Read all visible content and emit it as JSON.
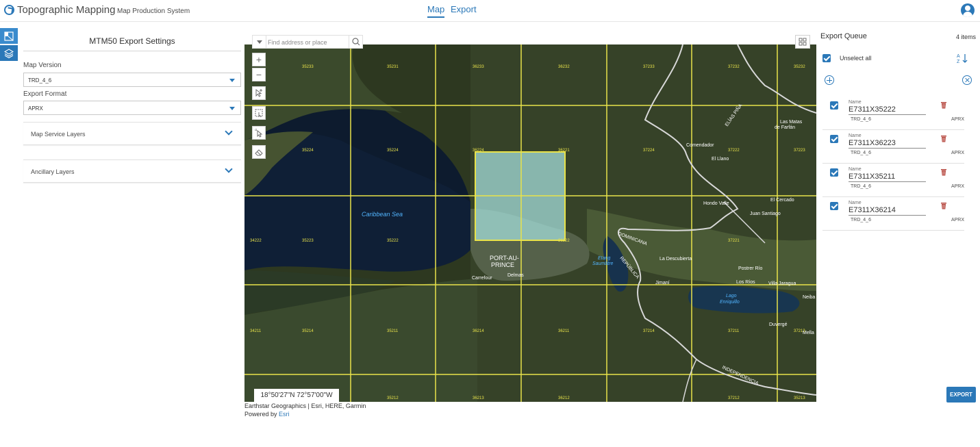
{
  "header": {
    "app_title": "Topographic Mapping",
    "app_subtitle": "Map Production System",
    "tabs": [
      {
        "label": "Map",
        "active": true
      },
      {
        "label": "Export",
        "active": false
      }
    ],
    "user_icon": "user-circle-icon"
  },
  "rail": {
    "items": [
      {
        "icon": "export-panel-icon",
        "active": true
      },
      {
        "icon": "layers-icon",
        "active": false
      }
    ]
  },
  "settings": {
    "title": "MTM50 Export Settings",
    "map_version_label": "Map Version",
    "map_version_value": "TRD_4_6",
    "export_format_label": "Export Format",
    "export_format_value": "APRX",
    "sections": [
      {
        "label": "Map Service Layers"
      },
      {
        "label": "Ancillary Layers"
      }
    ]
  },
  "map": {
    "search_placeholder": "Find address or place",
    "grid_labels": [
      "35233",
      "35231",
      "36233",
      "36232",
      "37233",
      "37232",
      "35232",
      "35224",
      "35224",
      "36224",
      "36221",
      "37224",
      "37222",
      "37223",
      "34222",
      "35223",
      "35222",
      "36222",
      "37221",
      "34211",
      "35214",
      "35211",
      "36214",
      "36211",
      "37214",
      "37211",
      "37213",
      "35212",
      "36213",
      "36212",
      "37212",
      "35213"
    ],
    "places": [
      "Comendador",
      "El Llano",
      "Hondo Valle",
      "El Cercado",
      "Juan Santiago",
      "PORT-AU-",
      "PRINCE",
      "Delmas",
      "Carrefour",
      "La Descubierta",
      "Postrer Río",
      "Los Ríos",
      "Villa Jaragua",
      "Jimaní",
      "Duvergé",
      "Las Matas",
      "de Farfán",
      "Neiba",
      "Mella"
    ],
    "water_labels": [
      "Caribbean Sea",
      "Etang",
      "Saumâtre",
      "Lago",
      "Enriquillo"
    ],
    "border_labels": [
      "ELÍAS PIÑA",
      "DOMINICANA",
      "REPÚBLICA",
      "INDEPENDENCIA"
    ],
    "coordinates": "18°50'27\"N 72°57'00\"W",
    "attribution": "Earthstar Geographics | Esri, HERE, Garmin",
    "powered_by_prefix": "Powered by",
    "powered_by_link": "Esri",
    "colors": {
      "grid": "#e9e34a",
      "selection_fill": "#a8e3e1",
      "border": "#d8d8d8"
    }
  },
  "queue": {
    "title": "Export Queue",
    "count": "4 items",
    "unselect_label": "Unselect all",
    "items": [
      {
        "name_label": "Name",
        "name": "E7311X35222",
        "version": "TRD_4_6",
        "format": "APRX",
        "checked": true
      },
      {
        "name_label": "Name",
        "name": "E7311X36223",
        "version": "TRD_4_6",
        "format": "APRX",
        "checked": true
      },
      {
        "name_label": "Name",
        "name": "E7311X35211",
        "version": "TRD_4_6",
        "format": "APRX",
        "checked": true
      },
      {
        "name_label": "Name",
        "name": "E7311X36214",
        "version": "TRD_4_6",
        "format": "APRX",
        "checked": true
      }
    ],
    "export_label": "EXPORT"
  }
}
